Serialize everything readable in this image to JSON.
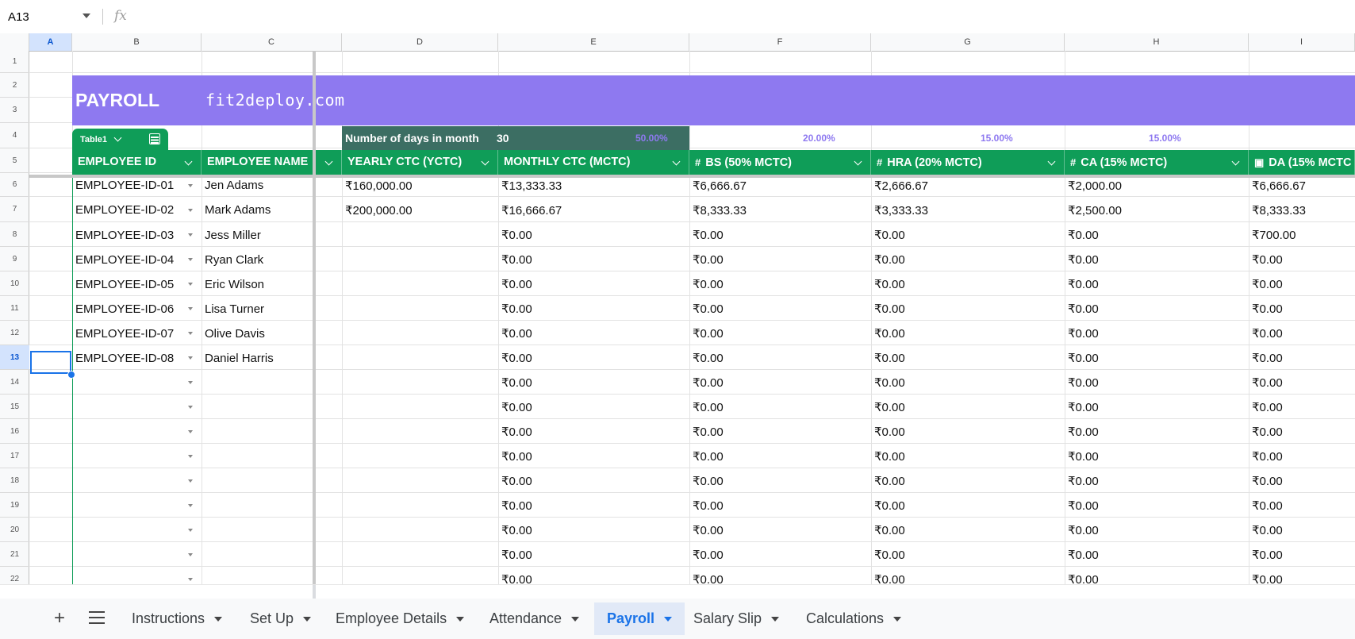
{
  "formula_bar": {
    "cell_ref": "A13",
    "fx_label": "fx"
  },
  "columns": [
    "A",
    "B",
    "C",
    "D",
    "E",
    "F",
    "G",
    "H",
    "I"
  ],
  "selected_column": "A",
  "rows": [
    "1",
    "2",
    "3",
    "4",
    "5",
    "6",
    "7",
    "8",
    "9",
    "10",
    "11",
    "12",
    "13",
    "14",
    "15",
    "16",
    "17",
    "18",
    "19",
    "20",
    "21",
    "22"
  ],
  "selected_row": "13",
  "banner": {
    "title": "PAYROLL",
    "site": "fit2deploy.com",
    "color": "#8e79f0"
  },
  "table_tab": {
    "name": "Table1"
  },
  "days": {
    "label": "Number of days in month",
    "value": "30"
  },
  "percentages": [
    "50.00%",
    "20.00%",
    "15.00%",
    "15.00%"
  ],
  "headers": [
    {
      "label": "EMPLOYEE ID",
      "type_icon": ""
    },
    {
      "label": "EMPLOYEE NAME",
      "type_icon": ""
    },
    {
      "label": "YEARLY CTC (YCTC)",
      "type_icon": ""
    },
    {
      "label": "MONTHLY CTC (MCTC)",
      "type_icon": ""
    },
    {
      "label": "BS (50% MCTC)",
      "type_icon": "#"
    },
    {
      "label": "HRA (20%  MCTC)",
      "type_icon": "#"
    },
    {
      "label": "CA (15%  MCTC)",
      "type_icon": "#"
    },
    {
      "label": "DA (15%  MCTC",
      "type_icon": "▣"
    }
  ],
  "data_rows": [
    {
      "id": "EMPLOYEE-ID-01",
      "name": "Jen Adams",
      "yctc": "₹160,000.00",
      "mctc": "₹13,333.33",
      "bs": "₹6,666.67",
      "hra": "₹2,666.67",
      "ca": "₹2,000.00",
      "da": "₹6,666.67"
    },
    {
      "id": "EMPLOYEE-ID-02",
      "name": "Mark Adams",
      "yctc": "₹200,000.00",
      "mctc": "₹16,666.67",
      "bs": "₹8,333.33",
      "hra": "₹3,333.33",
      "ca": "₹2,500.00",
      "da": "₹8,333.33"
    },
    {
      "id": "EMPLOYEE-ID-03",
      "name": "Jess Miller",
      "yctc": "",
      "mctc": "₹0.00",
      "bs": "₹0.00",
      "hra": "₹0.00",
      "ca": "₹0.00",
      "da": "₹700.00"
    },
    {
      "id": "EMPLOYEE-ID-04",
      "name": "Ryan Clark",
      "yctc": "",
      "mctc": "₹0.00",
      "bs": "₹0.00",
      "hra": "₹0.00",
      "ca": "₹0.00",
      "da": "₹0.00"
    },
    {
      "id": "EMPLOYEE-ID-05",
      "name": "Eric Wilson",
      "yctc": "",
      "mctc": "₹0.00",
      "bs": "₹0.00",
      "hra": "₹0.00",
      "ca": "₹0.00",
      "da": "₹0.00"
    },
    {
      "id": "EMPLOYEE-ID-06",
      "name": "Lisa Turner",
      "yctc": "",
      "mctc": "₹0.00",
      "bs": "₹0.00",
      "hra": "₹0.00",
      "ca": "₹0.00",
      "da": "₹0.00"
    },
    {
      "id": "EMPLOYEE-ID-07",
      "name": "Olive Davis",
      "yctc": "",
      "mctc": "₹0.00",
      "bs": "₹0.00",
      "hra": "₹0.00",
      "ca": "₹0.00",
      "da": "₹0.00"
    },
    {
      "id": "EMPLOYEE-ID-08",
      "name": "Daniel Harris",
      "yctc": "",
      "mctc": "₹0.00",
      "bs": "₹0.00",
      "hra": "₹0.00",
      "ca": "₹0.00",
      "da": "₹0.00"
    },
    {
      "id": "",
      "name": "",
      "yctc": "",
      "mctc": "₹0.00",
      "bs": "₹0.00",
      "hra": "₹0.00",
      "ca": "₹0.00",
      "da": "₹0.00"
    },
    {
      "id": "",
      "name": "",
      "yctc": "",
      "mctc": "₹0.00",
      "bs": "₹0.00",
      "hra": "₹0.00",
      "ca": "₹0.00",
      "da": "₹0.00"
    },
    {
      "id": "",
      "name": "",
      "yctc": "",
      "mctc": "₹0.00",
      "bs": "₹0.00",
      "hra": "₹0.00",
      "ca": "₹0.00",
      "da": "₹0.00"
    },
    {
      "id": "",
      "name": "",
      "yctc": "",
      "mctc": "₹0.00",
      "bs": "₹0.00",
      "hra": "₹0.00",
      "ca": "₹0.00",
      "da": "₹0.00"
    },
    {
      "id": "",
      "name": "",
      "yctc": "",
      "mctc": "₹0.00",
      "bs": "₹0.00",
      "hra": "₹0.00",
      "ca": "₹0.00",
      "da": "₹0.00"
    },
    {
      "id": "",
      "name": "",
      "yctc": "",
      "mctc": "₹0.00",
      "bs": "₹0.00",
      "hra": "₹0.00",
      "ca": "₹0.00",
      "da": "₹0.00"
    },
    {
      "id": "",
      "name": "",
      "yctc": "",
      "mctc": "₹0.00",
      "bs": "₹0.00",
      "hra": "₹0.00",
      "ca": "₹0.00",
      "da": "₹0.00"
    },
    {
      "id": "",
      "name": "",
      "yctc": "",
      "mctc": "₹0.00",
      "bs": "₹0.00",
      "hra": "₹0.00",
      "ca": "₹0.00",
      "da": "₹0.00"
    },
    {
      "id": "",
      "name": "",
      "yctc": "",
      "mctc": "₹0.00",
      "bs": "₹0.00",
      "hra": "₹0.00",
      "ca": "₹0.00",
      "da": "₹0.00"
    }
  ],
  "sheet_tabs": [
    {
      "label": "Instructions",
      "active": false
    },
    {
      "label": "Set Up",
      "active": false
    },
    {
      "label": "Employee Details",
      "active": false
    },
    {
      "label": "Attendance",
      "active": false
    },
    {
      "label": "Payroll",
      "active": true
    },
    {
      "label": "Salary Slip",
      "active": false
    },
    {
      "label": "Calculations",
      "active": false
    }
  ],
  "icons": {
    "add_sheet": "plus-icon",
    "all_sheets": "menu-icon",
    "table_icon": "table-icon"
  }
}
